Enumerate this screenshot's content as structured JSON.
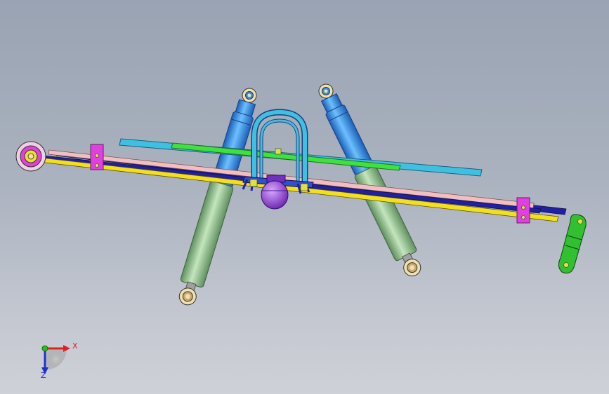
{
  "viewport": {
    "background_top": "#9aa3b3",
    "background_bottom": "#cfd1d8"
  },
  "triad": {
    "x_label": "X",
    "z_label": "Z",
    "x_color": "#e02020",
    "y_color": "#20c020",
    "z_color": "#2030d0"
  },
  "parts": {
    "leaf_spring_main": "#f0e020",
    "leaf_spring_second": "#2020a0",
    "leaf_spring_third": "#f0c0c0",
    "helper_leaf_green": "#40e040",
    "helper_leaf_cyan": "#40c0e0",
    "u_bolt": "#40c0e0",
    "bump_stop": "#9040e0",
    "spring_clip": "#e040e0",
    "shackle": "#30c030",
    "front_eye_bushing": "#e040e0",
    "shock_upper": "#3090e0",
    "shock_lower": "#90c090",
    "shock_eye": "#e0c070"
  }
}
